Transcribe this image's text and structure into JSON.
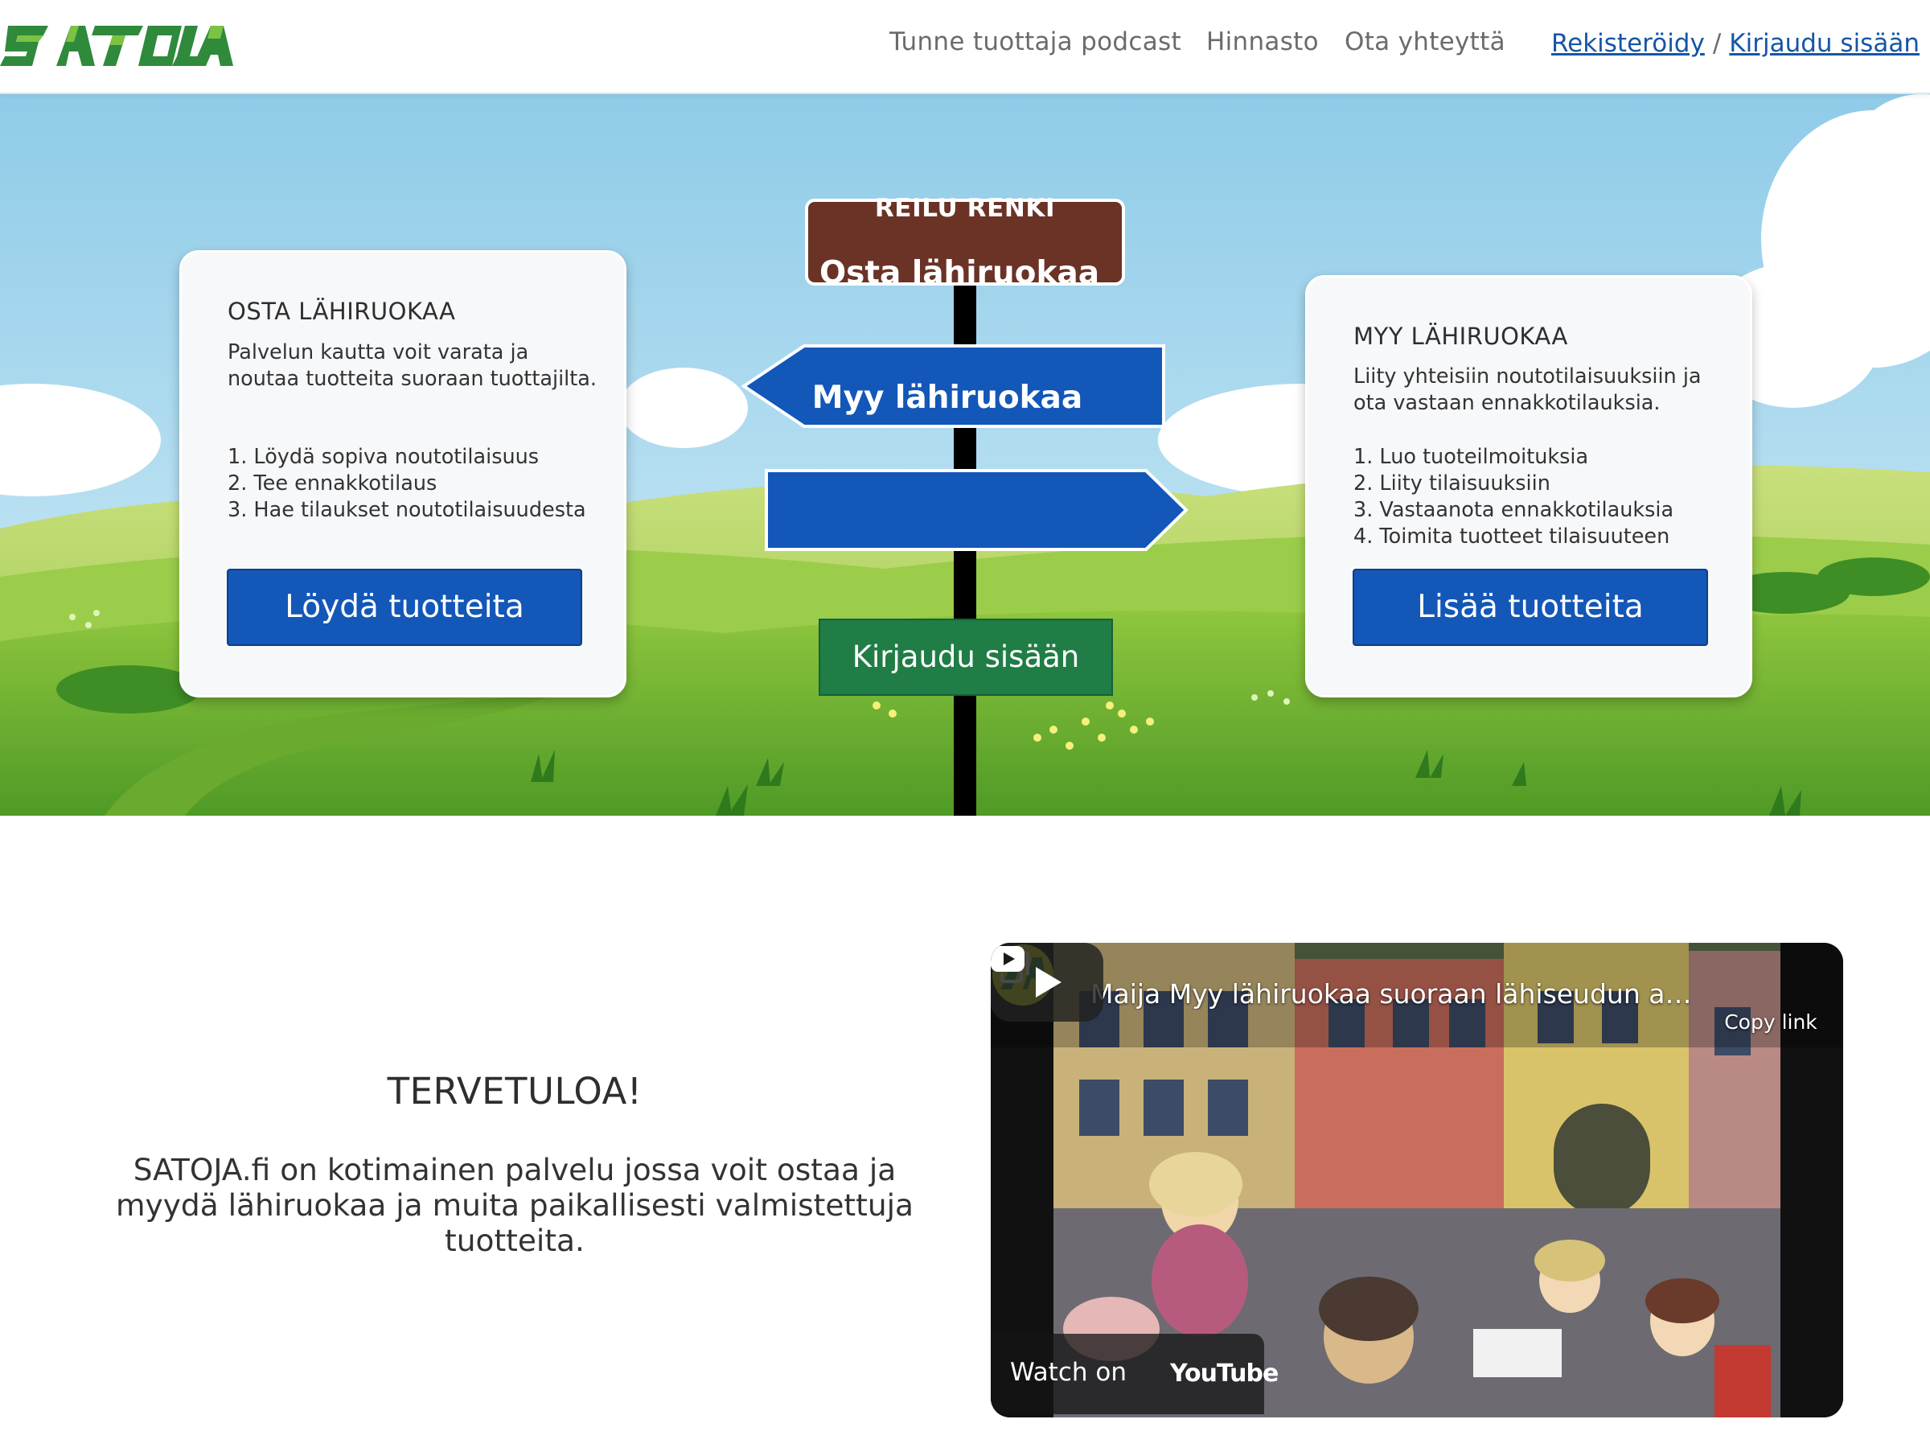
{
  "header": {
    "logo_text": "SATOJA",
    "nav": [
      "Tunne tuottaja podcast",
      "Hinnasto",
      "Ota yhteyttä"
    ],
    "register_label": "Rekisteröidy",
    "separator": "/",
    "login_label": "Kirjaudu sisään"
  },
  "hero": {
    "top_sign": "REILU RENKI",
    "left_sign": "Osta lähiruokaa",
    "right_sign": "Myy lähiruokaa",
    "login_sign": "Kirjaudu sisään",
    "buy_card": {
      "title": "OSTA LÄHIRUOKAA",
      "text": "Palvelun kautta voit varata ja noutaa tuotteita suoraan tuottajilta.",
      "steps": [
        "1. Löydä sopiva noutotilaisuus",
        "2. Tee ennakkotilaus",
        "3. Hae tilaukset noutotilaisuudesta"
      ],
      "button": "Löydä tuotteita"
    },
    "sell_card": {
      "title": "MYY LÄHIRUOKAA",
      "text": "Liity yhteisiin noutotilaisuuksiin ja ota vastaan ennakkotilauksia.",
      "steps": [
        "1. Luo tuoteilmoituksia",
        "2. Liity tilaisuuksiin",
        "3. Vastaanota ennakkotilauksia",
        "4. Toimita tuotteet tilaisuuteen"
      ],
      "button": "Lisää tuotteita"
    }
  },
  "welcome": {
    "title": "TERVETULOA!",
    "text": "SATOJA.fi on kotimainen palvelu jossa voit ostaa ja myydä lähiruokaa ja muita paikallisesti valmistettuja tuotteita."
  },
  "video": {
    "title": "Maija Myy lähiruokaa suoraan lähiseudun asu...",
    "copy_link": "Copy link",
    "watch_on": "Watch on",
    "youtube": "YouTube"
  },
  "colors": {
    "brand_green": "#2f8a3c",
    "button_blue": "#1357b8",
    "sign_brown": "#6a3326",
    "sign_green": "#1f7d45",
    "link_blue": "#1656a6"
  },
  "icons": [
    "copy-link-icon",
    "play-icon",
    "youtube-logo-icon",
    "channel-avatar-icon"
  ]
}
